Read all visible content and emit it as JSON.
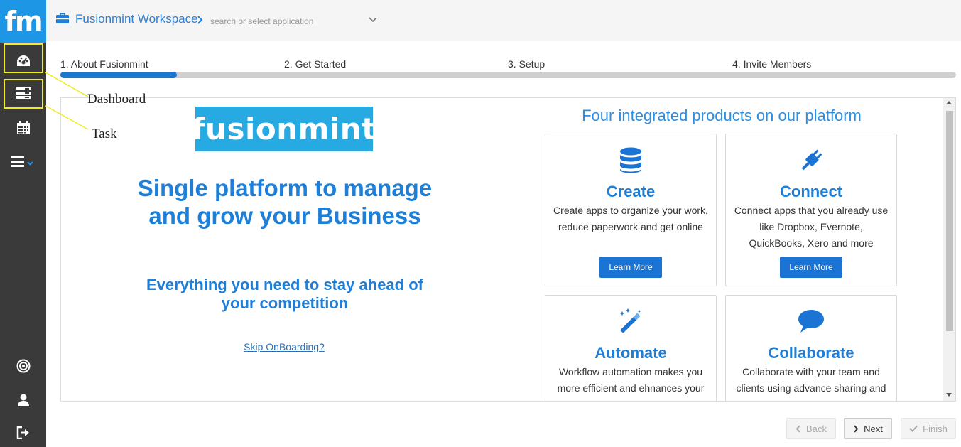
{
  "sidebar": {
    "logo": "fm",
    "icons": [
      "dashboard-icon",
      "task-icon",
      "calendar-icon",
      "menu-icon",
      "target-icon",
      "user-icon",
      "logout-icon"
    ]
  },
  "header": {
    "title": "Fusionmint Workspace",
    "search_placeholder": "search or select application"
  },
  "steps": {
    "items": [
      {
        "label": "1. About Fusionmint"
      },
      {
        "label": "2. Get Started"
      },
      {
        "label": "3. Setup"
      },
      {
        "label": "4. Invite Members"
      }
    ],
    "progress": 0.13
  },
  "intro": {
    "brand": "fusionmint",
    "headline_line1": "Single platform to manage",
    "headline_line2": "and grow your Business",
    "subline_line1": "Everything you need to stay ahead of",
    "subline_line2": "your competition",
    "skip_link": "Skip OnBoarding?"
  },
  "products": {
    "title": "Four integrated products on our platform",
    "cards": [
      {
        "icon": "database-icon",
        "title": "Create",
        "desc": "Create apps to organize your work, reduce paperwork and get online",
        "button": "Learn More"
      },
      {
        "icon": "plug-icon",
        "title": "Connect",
        "desc": "Connect apps that you already use like Dropbox, Evernote, QuickBooks, Xero and more",
        "button": "Learn More"
      },
      {
        "icon": "magic-wand-icon",
        "title": "Automate",
        "desc": "Workflow automation makes you more efficient and ehnances your"
      },
      {
        "icon": "chat-bubble-icon",
        "title": "Collaborate",
        "desc": "Collaborate with your team and clients using advance sharing and"
      }
    ]
  },
  "footer": {
    "back": "Back",
    "next": "Next",
    "finish": "Finish"
  },
  "annotations": {
    "dashboard": "Dashboard",
    "task": "Task",
    "highlight_color": "#f0ec1e"
  },
  "colors": {
    "sidebar_bg": "#3a3a3a",
    "logo_bg": "#1e96e6",
    "accent": "#1e7fd9",
    "button": "#1b74d3"
  }
}
